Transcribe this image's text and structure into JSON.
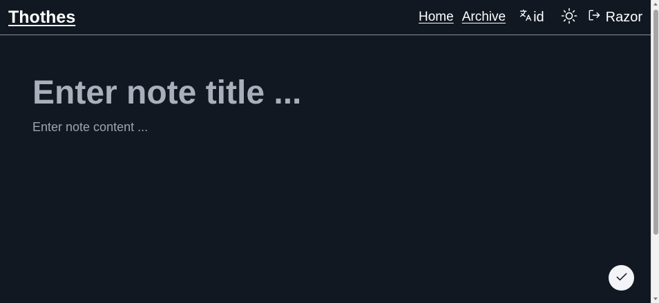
{
  "header": {
    "brand": "Thothes",
    "nav": {
      "home": "Home",
      "archive": "Archive"
    },
    "language": {
      "icon": "translate-icon",
      "code": "id"
    },
    "theme": {
      "icon": "sun-icon"
    },
    "user": {
      "icon": "logout-icon",
      "name": "Razor"
    }
  },
  "editor": {
    "title_placeholder": "Enter note title ...",
    "title_value": "",
    "content_placeholder": "Enter note content ...",
    "content_value": ""
  },
  "actions": {
    "save_icon": "check-icon"
  },
  "colors": {
    "background": "#111822",
    "header_border": "#8b9099",
    "placeholder": "#a9b0bb",
    "fab_background": "#f2f4f7"
  }
}
